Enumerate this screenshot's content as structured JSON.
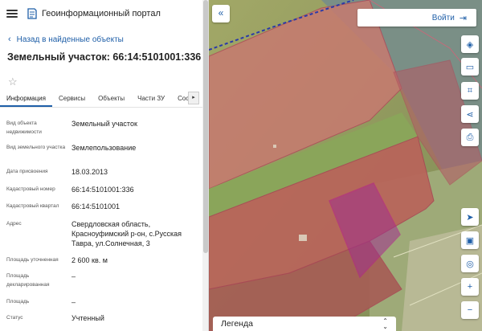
{
  "header": {
    "title": "Геоинформационный портал"
  },
  "nav": {
    "back": "Назад в найденные объекты"
  },
  "object": {
    "title": "Земельный участок: 66:14:5101001:336"
  },
  "tabs": [
    "Информация",
    "Сервисы",
    "Объекты",
    "Части ЗУ",
    "Соста"
  ],
  "rows": [
    {
      "label": "Вид объекта недвижимости",
      "value": "Земельный участок"
    },
    {
      "label": "Вид земельного участка",
      "value": "Землепользование"
    },
    {
      "label": "Дата присвоения",
      "value": "18.03.2013"
    },
    {
      "label": "Кадастровый номер",
      "value": "66:14:5101001:336"
    },
    {
      "label": "Кадастровый квартал",
      "value": "66:14:5101001"
    },
    {
      "label": "Адрес",
      "value": "Свердловская область, Красноуфимский р-он, с.Русская Тавра, ул.Солнечная, 3"
    },
    {
      "label": "Площадь уточненная",
      "value": "2 600 кв. м"
    },
    {
      "label": "Площадь декларированная",
      "value": "–"
    },
    {
      "label": "Площадь",
      "value": "–"
    },
    {
      "label": "Статус",
      "value": "Учтенный"
    }
  ],
  "map": {
    "login": "Войти",
    "legend": "Легенда",
    "tools": [
      "layers-icon",
      "ruler-icon",
      "qr-scan-icon",
      "share-icon",
      "print-icon",
      "locate-icon",
      "basemap-icon",
      "search-location-icon",
      "zoom-in-icon",
      "zoom-out-icon"
    ]
  },
  "colors": {
    "accent": "#1f5fa8",
    "parcel_fill": "#c85a6a",
    "selected_parcel": "#a0308e",
    "field_green": "#8aa55a"
  }
}
